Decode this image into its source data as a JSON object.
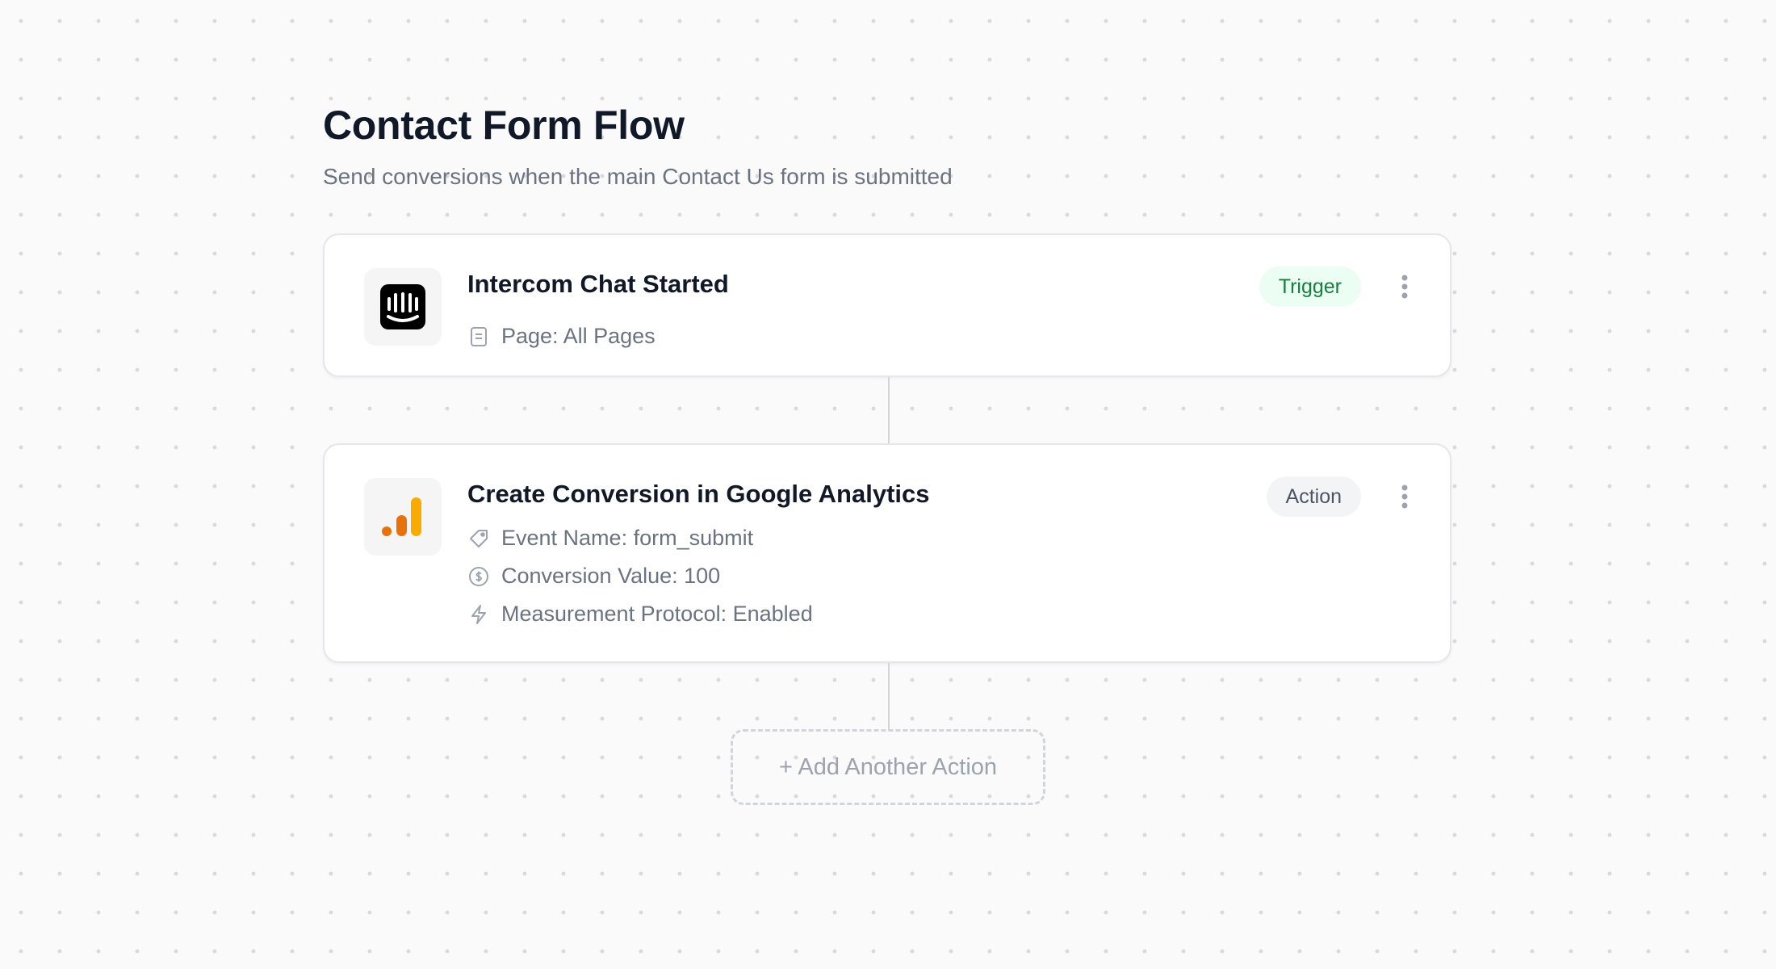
{
  "flow": {
    "title": "Contact Form Flow",
    "subtitle": "Send conversions when the main Contact Us form is submitted"
  },
  "steps": [
    {
      "title": "Intercom Chat Started",
      "badge": "Trigger",
      "logo_icon": "intercom-logo",
      "details": [
        {
          "icon": "page-icon",
          "text": "Page: All Pages"
        }
      ]
    },
    {
      "title": "Create Conversion in Google Analytics",
      "badge": "Action",
      "logo_icon": "google-analytics-logo",
      "details": [
        {
          "icon": "tag-icon",
          "text": "Event Name: form_submit"
        },
        {
          "icon": "dollar-circle-icon",
          "text": "Conversion Value: 100"
        },
        {
          "icon": "lightning-icon",
          "text": "Measurement Protocol: Enabled"
        }
      ]
    }
  ],
  "add_action": {
    "label": "+ Add Another Action"
  },
  "colors": {
    "trigger_badge_bg": "#ecfdf3",
    "trigger_badge_text": "#15803d",
    "action_badge_bg": "#f3f4f6",
    "action_badge_text": "#4b5563",
    "ga_orange_dark": "#e8710a",
    "ga_orange_light": "#f9ab00"
  }
}
